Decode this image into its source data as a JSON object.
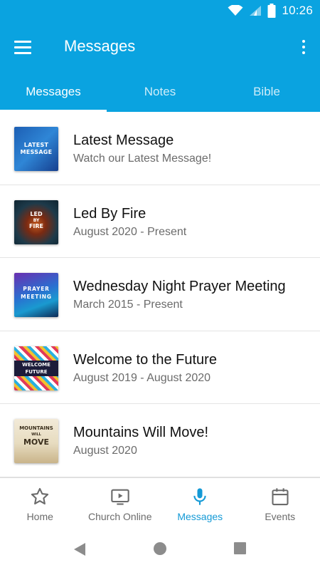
{
  "status_bar": {
    "time": "10:26"
  },
  "toolbar": {
    "title": "Messages"
  },
  "tabs": [
    {
      "label": "Messages",
      "active": true
    },
    {
      "label": "Notes",
      "active": false
    },
    {
      "label": "Bible",
      "active": false
    }
  ],
  "messages": [
    {
      "title": "Latest Message",
      "subtitle": "Watch our Latest Message!",
      "thumb_text": [
        "LATEST",
        "MESSAGE"
      ]
    },
    {
      "title": "Led By Fire",
      "subtitle": "August 2020 - Present",
      "thumb_text": [
        "LED",
        "BY",
        "FIRE"
      ]
    },
    {
      "title": "Wednesday Night Prayer Meeting",
      "subtitle": "March 2015 - Present",
      "thumb_text": [
        "PRAYER",
        "MEETING"
      ]
    },
    {
      "title": "Welcome to the Future",
      "subtitle": "August 2019 - August 2020",
      "thumb_text": [
        "WELCOME",
        "FUTURE"
      ]
    },
    {
      "title": "Mountains Will Move!",
      "subtitle": "August 2020",
      "thumb_text": [
        "MOUNTAINS",
        "WILL",
        "MOVE"
      ]
    }
  ],
  "bottom_nav": [
    {
      "label": "Home",
      "icon": "star-icon",
      "active": false
    },
    {
      "label": "Church Online",
      "icon": "tv-play-icon",
      "active": false
    },
    {
      "label": "Messages",
      "icon": "microphone-icon",
      "active": true
    },
    {
      "label": "Events",
      "icon": "calendar-icon",
      "active": false
    }
  ],
  "colors": {
    "primary": "#0aa3e0",
    "nav_active": "#149ad6",
    "nav_inactive": "#6b6b6b"
  }
}
